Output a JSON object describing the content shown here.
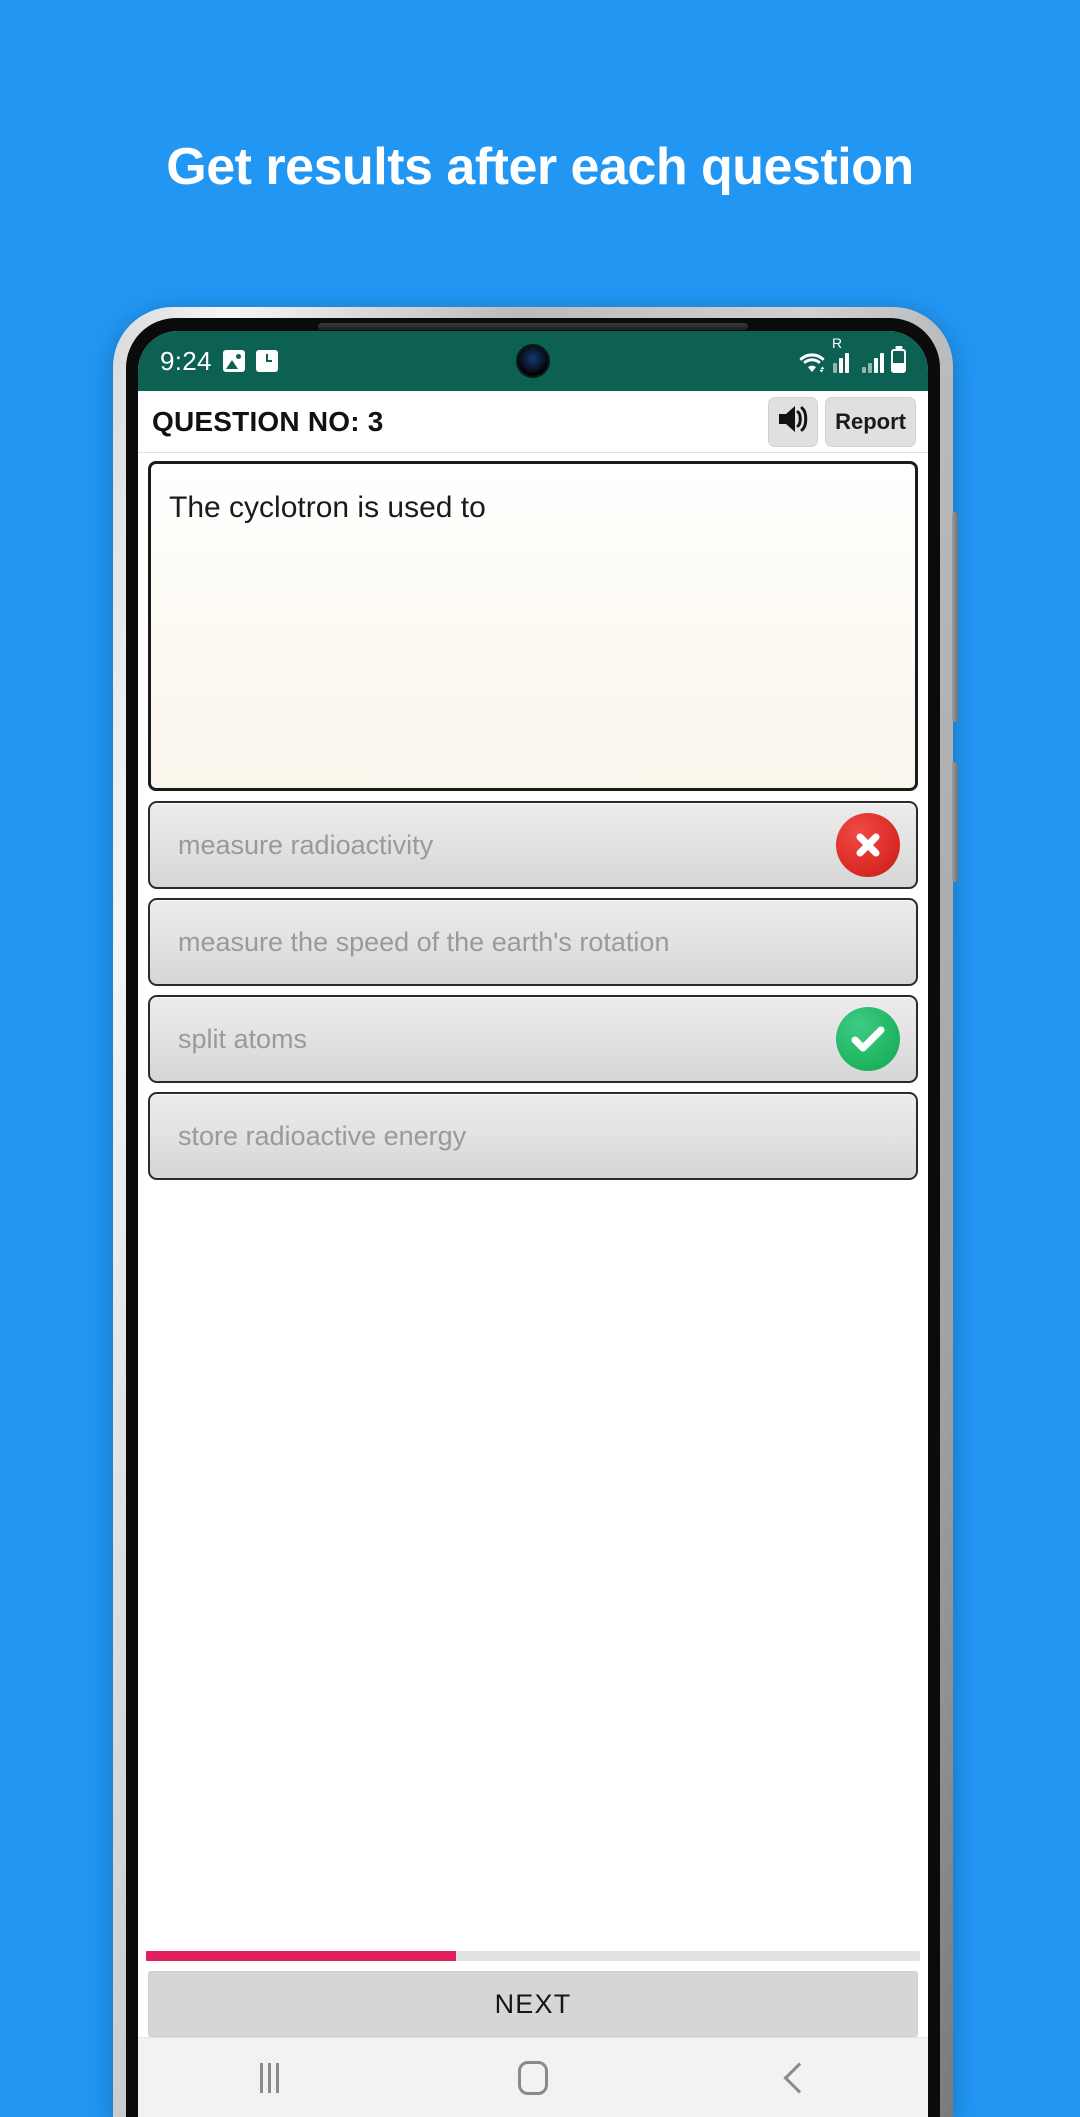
{
  "promo": {
    "headline": "Get results after each question",
    "background_color": "#2196f3",
    "text_color": "#ffffff"
  },
  "status_bar": {
    "time": "9:24",
    "background_color": "#0d6152",
    "icons": [
      "photo-icon",
      "clock-icon",
      "wifi-icon",
      "roaming-signal-icon",
      "signal-icon",
      "battery-icon"
    ],
    "roaming_label": "R"
  },
  "app_header": {
    "question_label": "QUESTION NO: 3",
    "speaker_button": "speaker-icon",
    "report_label": "Report"
  },
  "question": {
    "text": "The cyclotron is used to"
  },
  "options": [
    {
      "label": "measure radioactivity",
      "state": "wrong",
      "badge": "cross-icon"
    },
    {
      "label": "measure the speed of the earth's rotation",
      "state": "neutral",
      "badge": ""
    },
    {
      "label": "split atoms",
      "state": "correct",
      "badge": "check-icon"
    },
    {
      "label": "store radioactive energy",
      "state": "neutral",
      "badge": ""
    }
  ],
  "progress": {
    "percent": 40,
    "fill_color": "#e0215e",
    "track_color": "#e2e2e2"
  },
  "footer": {
    "next_label": "NEXT"
  },
  "navigation_bar": {
    "recents": "recents-icon",
    "home": "home-icon",
    "back": "back-icon"
  }
}
